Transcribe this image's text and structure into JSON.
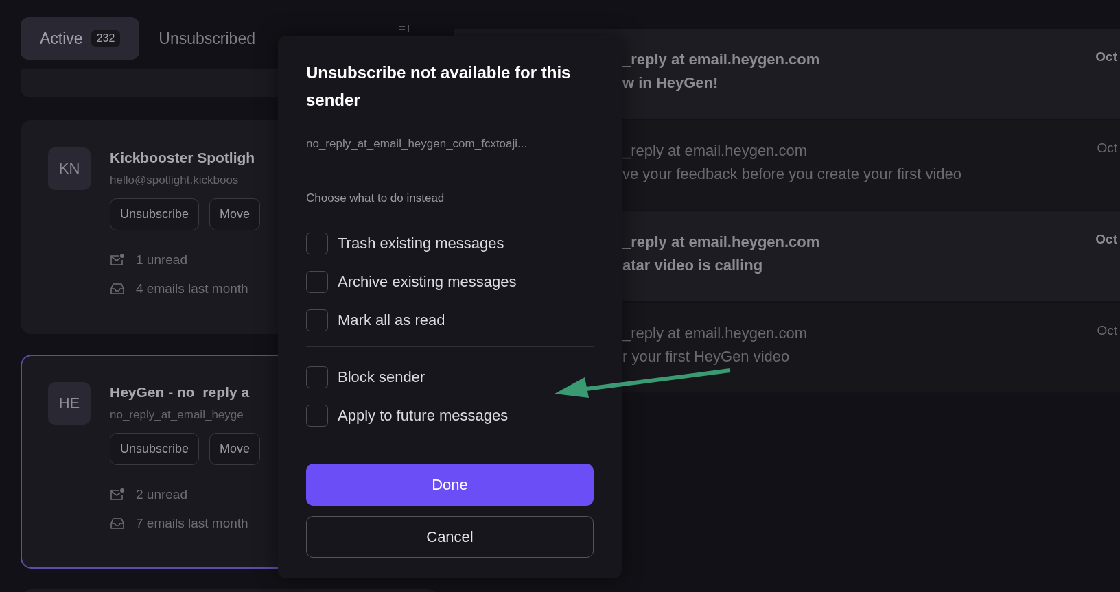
{
  "tabs": [
    {
      "label": "Active",
      "count": "232",
      "selected": true
    },
    {
      "label": "Unsubscribed",
      "selected": false
    }
  ],
  "senders": [
    {
      "initials": "KN",
      "name": "Kickbooster Spotligh",
      "email": "hello@spotlight.kickboos",
      "actions": [
        "Unsubscribe",
        "Move"
      ],
      "unread": "1 unread",
      "volume": "4 emails last month",
      "selected": false
    },
    {
      "initials": "HE",
      "name": "HeyGen - no_reply a",
      "email": "no_reply_at_email_heyge",
      "actions": [
        "Unsubscribe",
        "Move"
      ],
      "unread": "2 unread",
      "volume": "7 emails last month",
      "selected": true
    }
  ],
  "messages": [
    {
      "sender": "_reply at email.heygen.com",
      "subject": "w in HeyGen!",
      "date": "Oct",
      "unread": true
    },
    {
      "sender": "_reply at email.heygen.com",
      "subject": "ve your feedback before you create your first video",
      "date": "Oct",
      "unread": false
    },
    {
      "sender": "_reply at email.heygen.com",
      "subject": "atar video is calling",
      "date": "Oct",
      "unread": true
    },
    {
      "sender": "_reply at email.heygen.com",
      "subject": "r your first HeyGen video",
      "date": "Oct",
      "unread": false
    }
  ],
  "dialog": {
    "title": "Unsubscribe not available for this sender",
    "email": "no_reply_at_email_heygen_com_fcxtoaji...",
    "prompt": "Choose what to do instead",
    "option_groups": [
      {
        "options": [
          {
            "label": "Trash existing messages",
            "checked": false
          },
          {
            "label": "Archive existing messages",
            "checked": false
          },
          {
            "label": "Mark all as read",
            "checked": false
          }
        ]
      },
      {
        "options": [
          {
            "label": "Block sender",
            "checked": false
          },
          {
            "label": "Apply to future messages",
            "checked": false
          }
        ]
      }
    ],
    "buttons": [
      {
        "label": "Done",
        "kind": "primary"
      },
      {
        "label": "Cancel",
        "kind": "secondary"
      }
    ]
  }
}
